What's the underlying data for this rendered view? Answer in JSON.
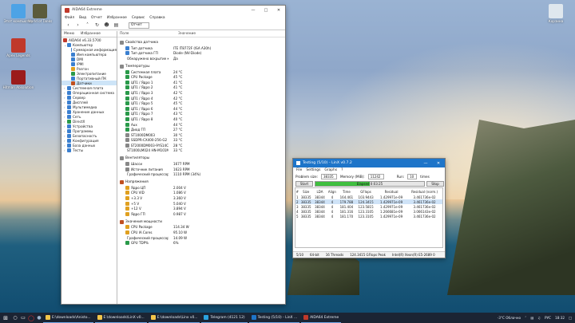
{
  "desktop": {
    "icons": [
      {
        "label": "Этот компьютер",
        "color": "#4da3e6"
      },
      {
        "label": "World of Tanks",
        "color": "#5b5b3b"
      },
      {
        "label": "Apex Legends",
        "color": "#c0392b"
      },
      {
        "label": "Hitman Absolution",
        "color": "#9b1b1b"
      },
      {
        "label": "Корзина",
        "color": "#dfe7ee"
      }
    ]
  },
  "aida": {
    "title": "AIDA64 Extreme",
    "menu": [
      "Файл",
      "Вид",
      "Отчет",
      "Избранное",
      "Сервис",
      "Справка"
    ],
    "crumb": "Отчет",
    "tabs": [
      "Меню",
      "Избранное"
    ],
    "tree_root": "AIDA64 v6.33.5700",
    "tree": [
      {
        "label": "Компьютер",
        "c": "#3a7fd0",
        "lv": 1,
        "open": true
      },
      {
        "label": "Суммарная информация",
        "c": "#3a7fd0",
        "lv": 2
      },
      {
        "label": "Имя компьютера",
        "c": "#3a7fd0",
        "lv": 2
      },
      {
        "label": "DMI",
        "c": "#3a7fd0",
        "lv": 2
      },
      {
        "label": "IPMI",
        "c": "#3a7fd0",
        "lv": 2
      },
      {
        "label": "Разгон",
        "c": "#e0a020",
        "lv": 2
      },
      {
        "label": "Электропитание",
        "c": "#2a9a4a",
        "lv": 2
      },
      {
        "label": "Портативный ПК",
        "c": "#3a7fd0",
        "lv": 2
      },
      {
        "label": "Датчики",
        "c": "#c05020",
        "lv": 2,
        "sel": true
      },
      {
        "label": "Системная плата",
        "c": "#3a7fd0",
        "lv": 1
      },
      {
        "label": "Операционная система",
        "c": "#3a7fd0",
        "lv": 1
      },
      {
        "label": "Сервер",
        "c": "#3a7fd0",
        "lv": 1
      },
      {
        "label": "Дисплей",
        "c": "#3a7fd0",
        "lv": 1
      },
      {
        "label": "Мультимедиа",
        "c": "#3a7fd0",
        "lv": 1
      },
      {
        "label": "Хранение данных",
        "c": "#3a7fd0",
        "lv": 1
      },
      {
        "label": "Сеть",
        "c": "#3a7fd0",
        "lv": 1
      },
      {
        "label": "DirectX",
        "c": "#2a9a4a",
        "lv": 1
      },
      {
        "label": "Устройства",
        "c": "#3a7fd0",
        "lv": 1
      },
      {
        "label": "Программы",
        "c": "#3a7fd0",
        "lv": 1
      },
      {
        "label": "Безопасность",
        "c": "#3a7fd0",
        "lv": 1
      },
      {
        "label": "Конфигурация",
        "c": "#3a7fd0",
        "lv": 1
      },
      {
        "label": "База данных",
        "c": "#3a7fd0",
        "lv": 1
      },
      {
        "label": "Тесты",
        "c": "#3a7fd0",
        "lv": 1
      }
    ],
    "col_field": "Поле",
    "col_value": "Значение",
    "sections": [
      {
        "title": "Свойства датчика",
        "c": "#888",
        "rows": [
          {
            "f": "Тип датчика",
            "v": "ITE IT8772F (ISA A30h)",
            "c": "#3a7fd0"
          },
          {
            "f": "Тип датчика ГП",
            "v": "Diode (NV-Diode)",
            "c": "#3a7fd0"
          },
          {
            "f": "Обнаружено вскрытие кор...",
            "v": "Да",
            "c": "#c05020"
          }
        ]
      },
      {
        "title": "Температуры",
        "c": "#888",
        "rows": [
          {
            "f": "Системная плата",
            "v": "24 °C",
            "c": "#2a9a4a"
          },
          {
            "f": "CPU Package",
            "v": "45 °C",
            "c": "#2a9a4a"
          },
          {
            "f": "ЦП1 / Ядро 1",
            "v": "41 °C",
            "c": "#2a9a4a"
          },
          {
            "f": "ЦП1 / Ядро 2",
            "v": "41 °C",
            "c": "#2a9a4a"
          },
          {
            "f": "ЦП1 / Ядро 3",
            "v": "42 °C",
            "c": "#2a9a4a"
          },
          {
            "f": "ЦП1 / Ядро 4",
            "v": "42 °C",
            "c": "#2a9a4a"
          },
          {
            "f": "ЦП1 / Ядро 5",
            "v": "45 °C",
            "c": "#2a9a4a"
          },
          {
            "f": "ЦП1 / Ядро 6",
            "v": "44 °C",
            "c": "#2a9a4a"
          },
          {
            "f": "ЦП1 / Ядро 7",
            "v": "43 °C",
            "c": "#2a9a4a"
          },
          {
            "f": "ЦП1 / Ядро 8",
            "v": "40 °C",
            "c": "#2a9a4a"
          },
          {
            "f": "Aux",
            "v": "44 °C",
            "c": "#2a9a4a"
          },
          {
            "f": "Диод ГП",
            "v": "27 °C",
            "c": "#2a9a4a"
          },
          {
            "f": "ST1000DM003",
            "v": "30 °C",
            "c": "#888"
          },
          {
            "f": "SSDPR-CX400-256-G2",
            "v": "33 °C",
            "c": "#888"
          },
          {
            "f": "ST2000DM003-9YS14C",
            "v": "28 °C",
            "c": "#888"
          },
          {
            "f": "ST1000LM024 HN-M101MBB",
            "v": "33 °C",
            "c": "#888"
          }
        ]
      },
      {
        "title": "Вентиляторы",
        "c": "#888",
        "rows": [
          {
            "f": "Шасси",
            "v": "1677 RPM",
            "c": "#888"
          },
          {
            "f": "Источник питания",
            "v": "1623 RPM",
            "c": "#888"
          },
          {
            "f": "Графический процессор",
            "v": "1110 RPM (34%)",
            "c": "#2a9a4a"
          }
        ]
      },
      {
        "title": "Напряжения",
        "c": "#c05020",
        "rows": [
          {
            "f": "Ядро ЦП",
            "v": "2.004 V",
            "c": "#e0a020"
          },
          {
            "f": "CPU VID",
            "v": "1.086 V",
            "c": "#e0a020"
          },
          {
            "f": "+3.3 V",
            "v": "3.360 V",
            "c": "#e0a020"
          },
          {
            "f": "+5 V",
            "v": "5.040 V",
            "c": "#e0a020"
          },
          {
            "f": "+12 V",
            "v": "3.894 V",
            "c": "#e0a020"
          },
          {
            "f": "Ядро ГП",
            "v": "0.987 V",
            "c": "#e0a020"
          }
        ]
      },
      {
        "title": "Значения мощности",
        "c": "#c05020",
        "rows": [
          {
            "f": "CPU Package",
            "v": "114.34 W",
            "c": "#e0a020"
          },
          {
            "f": "CPU IA Cores",
            "v": "95.10 W",
            "c": "#e0a020"
          },
          {
            "f": "Графический процессор",
            "v": "14.09 W",
            "c": "#2a9a4a"
          },
          {
            "f": "GPU TDP%",
            "v": "6%",
            "c": "#2a9a4a"
          }
        ]
      }
    ]
  },
  "linx": {
    "title": "Testing (5/10) - LinX v0.7.2",
    "menu": [
      "File",
      "Settings",
      "Graphs",
      "?"
    ],
    "problem_label": "Problem size:",
    "problem_value": "38335",
    "memory_label": "Memory (MiB):",
    "memory_value": "11242",
    "run_label": "Run:",
    "run_value": "10",
    "times_label": "times",
    "start_label": "Start",
    "stop_label": "Stop",
    "progress_text": "Elapsed 0:03:25",
    "progress": 0.5,
    "headers": [
      "#",
      "Size",
      "LDA",
      "Align",
      "Time",
      "GFlops",
      "Residual",
      "Residual (norm.)"
    ],
    "rows": [
      [
        "1",
        "38335",
        "38344",
        "4",
        "164.461",
        "103.9443",
        "1.429971e-09",
        "3.461736e-02"
      ],
      [
        "2",
        "38335",
        "38344",
        "4",
        "179.788",
        "124.3415",
        "1.429971e-09",
        "3.461736e-02"
      ],
      [
        "3",
        "38335",
        "38344",
        "4",
        "181.404",
        "123.5815",
        "1.429971e-09",
        "3.461736e-02"
      ],
      [
        "4",
        "38335",
        "38344",
        "4",
        "181.316",
        "123.3105",
        "1.266681e-09",
        "3.066143e-02"
      ],
      [
        "5",
        "38335",
        "38344",
        "4",
        "181.170",
        "123.3105",
        "1.429971e-09",
        "3.461736e-02"
      ]
    ],
    "highlighted_row": 1,
    "status": [
      "5/10",
      "64-bit",
      "16 Threads",
      "124.3415 GFlops Peak",
      "Intel(R) Xeon(R) E5-2689 0"
    ]
  },
  "taskbar": {
    "apps": [
      {
        "label": "E:\\downloads\\Anisto...",
        "color": "#f3c54a"
      },
      {
        "label": "E:\\downloads\\LinX v0...",
        "color": "#f3c54a"
      },
      {
        "label": "E:\\downloads\\Linx v0...",
        "color": "#f3c54a"
      },
      {
        "label": "Telegram (4121 12)",
        "color": "#2aa3e0"
      },
      {
        "label": "Testing (5/10) - LinX ...",
        "color": "#1e75c9"
      },
      {
        "label": "AIDA64 Extreme",
        "color": "#c0392b"
      }
    ],
    "weather": "-3°C Облачно",
    "lang": "РУС",
    "time": "18:32"
  }
}
